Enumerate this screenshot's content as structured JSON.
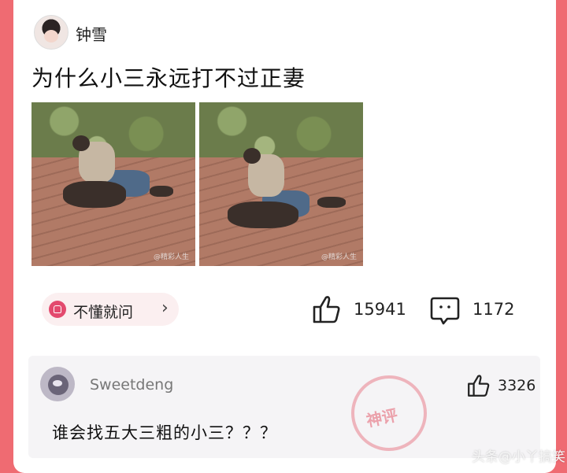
{
  "post": {
    "username": "钟雪",
    "title": "为什么小三永远打不过正妻",
    "photo_watermark": "@精彩人生"
  },
  "actions": {
    "ask_label": "不懂就问",
    "ask_chevron": "›",
    "likes": "15941",
    "comments": "1172"
  },
  "comment": {
    "author": "Sweetdeng",
    "likes": "3326",
    "text": "谁会找五大三粗的小三？？？",
    "stamp": "神评"
  },
  "credit": "头条@小丫搞笑",
  "colors": {
    "frame": "#ef6b72",
    "accent": "#e34a6e",
    "comment_bg": "#f5f4f6"
  }
}
